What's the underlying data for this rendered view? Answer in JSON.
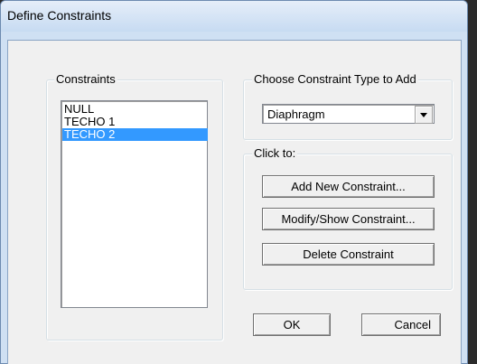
{
  "window": {
    "title": "Define Constraints"
  },
  "constraints_group": {
    "label": "Constraints",
    "items": [
      "NULL",
      "TECHO 1",
      "TECHO 2"
    ],
    "selected_index": 2
  },
  "type_group": {
    "label": "Choose Constraint Type to Add",
    "selected": "Diaphragm"
  },
  "click_group": {
    "label": "Click to:",
    "add_label": "Add New Constraint...",
    "modify_label": "Modify/Show Constraint...",
    "delete_label": "Delete Constraint"
  },
  "footer": {
    "ok_label": "OK",
    "cancel_label": "Cancel"
  },
  "colors": {
    "selection": "#3399ff",
    "title_gradient_top": "#e5eef9",
    "title_gradient_bottom": "#c7dbf2"
  },
  "icons": {
    "combo_arrow": "chevron-down-icon"
  }
}
